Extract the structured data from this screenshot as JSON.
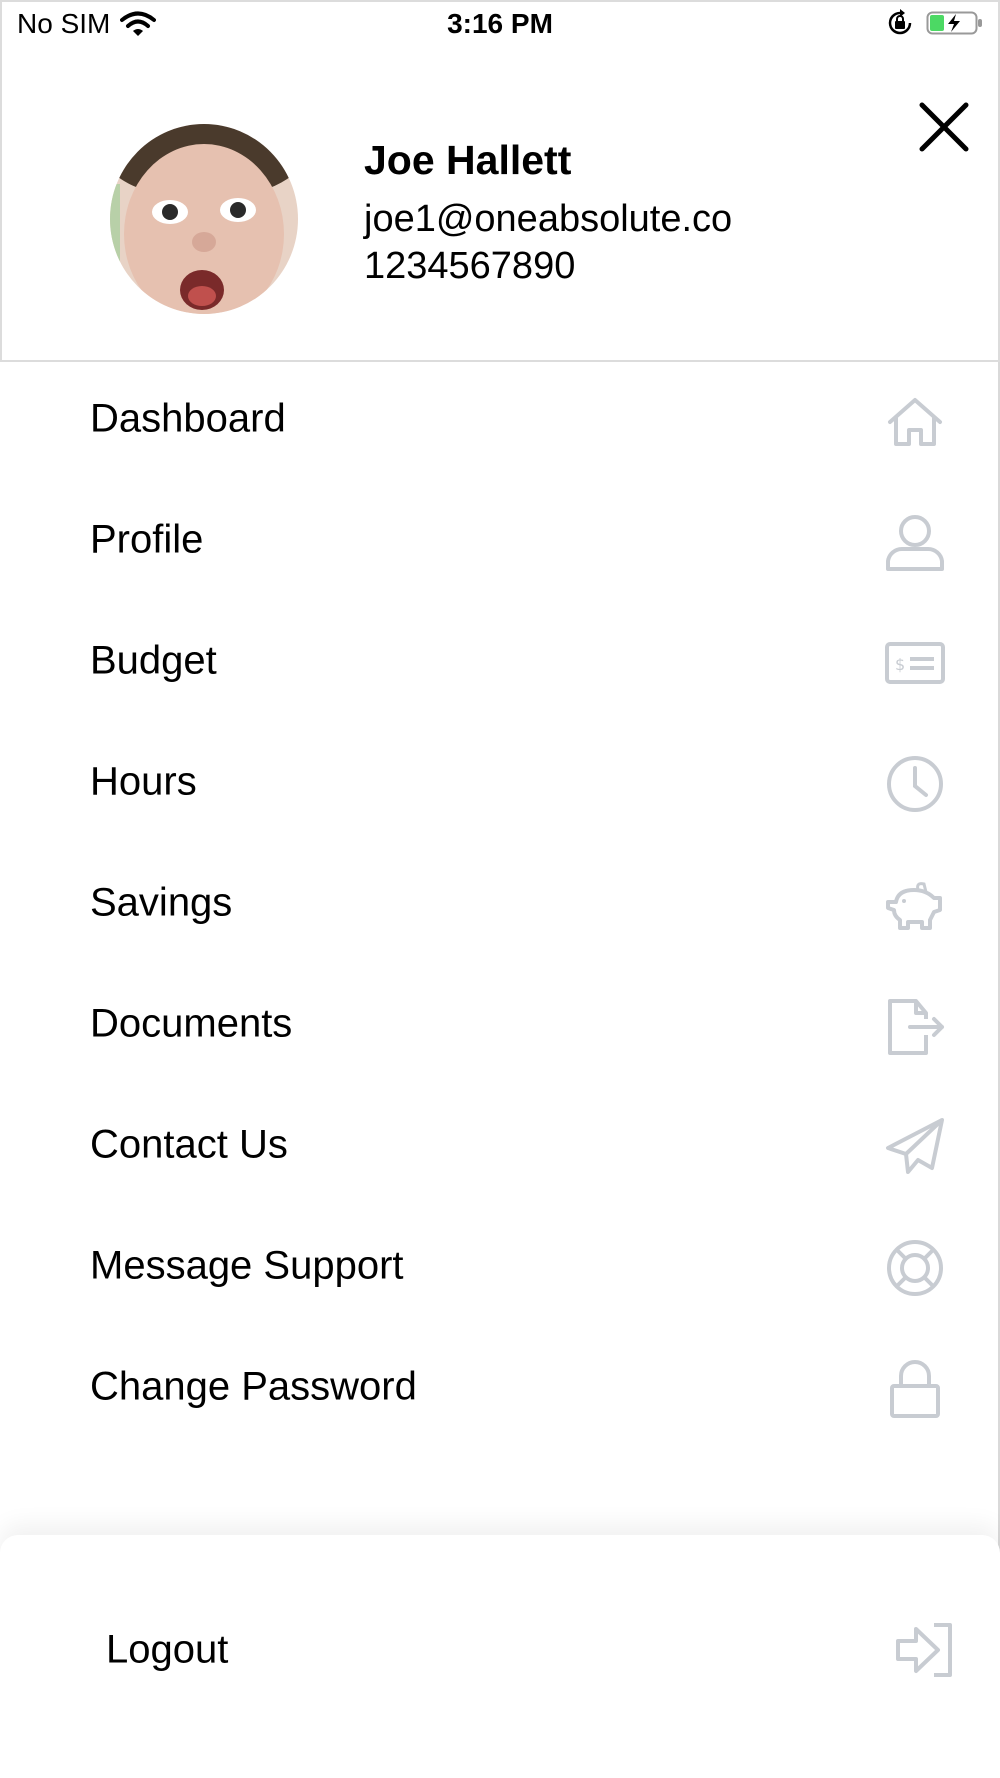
{
  "status_bar": {
    "carrier": "No SIM",
    "time": "3:16 PM"
  },
  "profile": {
    "name": "Joe Hallett",
    "email": "joe1@oneabsolute.co",
    "phone": "1234567890"
  },
  "menu": {
    "items": [
      {
        "label": "Dashboard",
        "icon": "home-icon"
      },
      {
        "label": "Profile",
        "icon": "user-icon"
      },
      {
        "label": "Budget",
        "icon": "dollar-bill-icon"
      },
      {
        "label": "Hours",
        "icon": "clock-icon"
      },
      {
        "label": "Savings",
        "icon": "piggy-bank-icon"
      },
      {
        "label": "Documents",
        "icon": "document-export-icon"
      },
      {
        "label": "Contact Us",
        "icon": "paper-plane-icon"
      },
      {
        "label": "Message Support",
        "icon": "life-ring-icon"
      },
      {
        "label": "Change Password",
        "icon": "lock-icon"
      }
    ]
  },
  "logout": {
    "label": "Logout",
    "icon": "sign-in-arrow-icon"
  },
  "colors": {
    "icon_gray": "#c8ccd2",
    "battery_green": "#4cd964"
  }
}
